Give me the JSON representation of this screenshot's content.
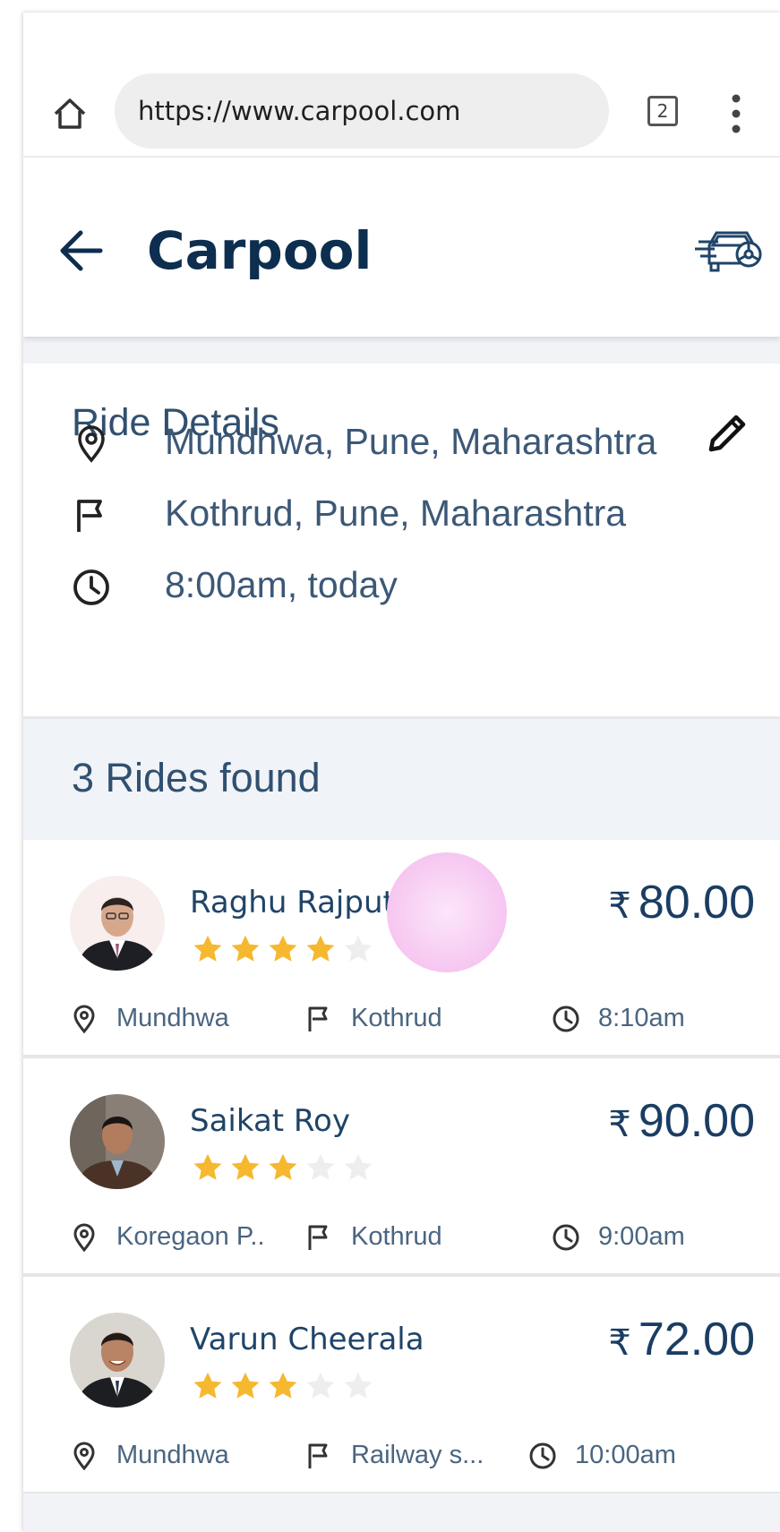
{
  "browser": {
    "url": "https://www.carpool.com",
    "tab_count": "2"
  },
  "header": {
    "title": "Carpool"
  },
  "ride_details": {
    "title": "Ride Details",
    "pickup": "Mundhwa, Pune, Maharashtra",
    "dropoff": "Kothrud, Pune, Maharashtra",
    "time": "8:00am, today"
  },
  "results": {
    "summary": "3 Rides found"
  },
  "currency_symbol": "₹",
  "rides": [
    {
      "driver": "Raghu Rajput",
      "rating": 4,
      "price": "80.00",
      "from": "Mundhwa",
      "to": "Kothrud",
      "time": "8:10am"
    },
    {
      "driver": "Saikat Roy",
      "rating": 3,
      "price": "90.00",
      "from": "Koregaon P..",
      "to": "Kothrud",
      "time": "9:00am"
    },
    {
      "driver": "Varun Cheerala",
      "rating": 3,
      "price": "72.00",
      "from": "Mundhwa",
      "to": "Railway s...",
      "time": "10:00am"
    }
  ],
  "colors": {
    "brand_text": "#0d2e4f",
    "star_filled": "#f5b82e",
    "star_empty": "#eeeeee",
    "section_bg": "#f0f3f8"
  },
  "icons": {
    "home": "home-icon",
    "tabs": "tabs-icon",
    "menu": "more-vert-icon",
    "back": "arrow-back-icon",
    "car": "car-icon",
    "edit": "pencil-icon",
    "pickup": "location-pin-icon",
    "dropoff": "flag-icon",
    "time": "clock-icon",
    "rating": "star-icon"
  }
}
